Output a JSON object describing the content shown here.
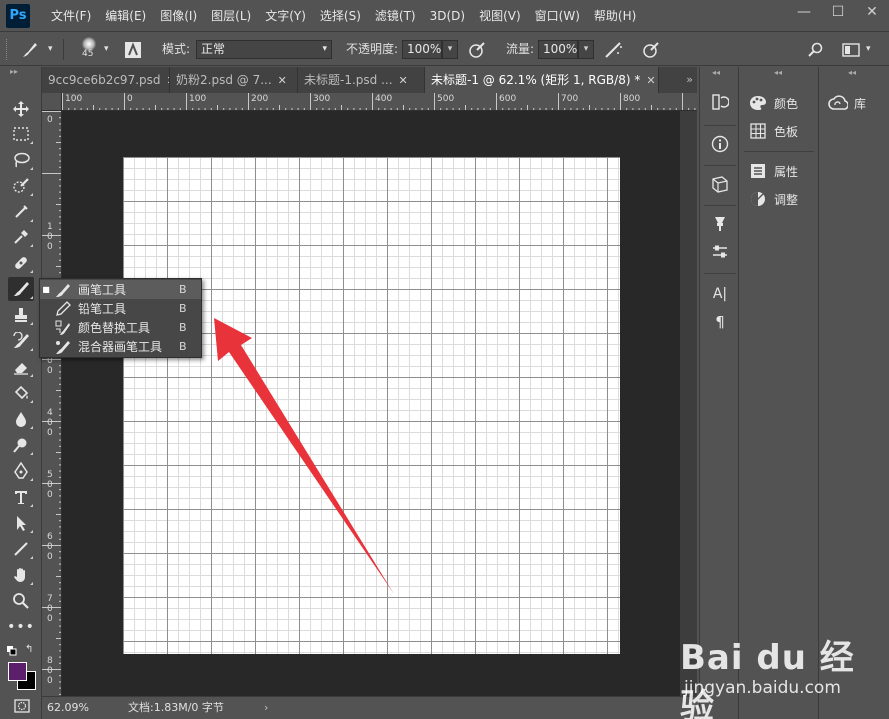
{
  "app": {
    "logo": "Ps"
  },
  "menubar": {
    "items": [
      "文件(F)",
      "编辑(E)",
      "图像(I)",
      "图层(L)",
      "文字(Y)",
      "选择(S)",
      "滤镜(T)",
      "3D(D)",
      "视图(V)",
      "窗口(W)",
      "帮助(H)"
    ]
  },
  "window_controls": {
    "minimize": "—",
    "maximize": "☐",
    "close": "✕"
  },
  "options": {
    "brush_size": "45",
    "mode_label": "模式:",
    "mode_value": "正常",
    "opacity_label": "不透明度:",
    "opacity_value": "100%",
    "flow_label": "流量:",
    "flow_value": "100%"
  },
  "tabs": [
    {
      "label": "9cc9ce6b2c97.psd",
      "close": "✕",
      "active": false
    },
    {
      "label": "奶粉2.psd @ 7...",
      "close": "✕",
      "active": false
    },
    {
      "label": "未标题-1.psd ...",
      "close": "✕",
      "active": false
    },
    {
      "label": "未标题-1 @ 62.1% (矩形 1, RGB/8) *",
      "close": "✕",
      "active": true
    }
  ],
  "tab_overflow": "»",
  "ruler": {
    "h_labels": [
      "100",
      "0",
      "100",
      "200",
      "300",
      "400",
      "500",
      "600",
      "700",
      "800"
    ],
    "v_labels": [
      "0",
      "100",
      "200",
      "300",
      "400",
      "500",
      "600",
      "700",
      "800"
    ]
  },
  "flyout": {
    "items": [
      {
        "label": "画笔工具",
        "key": "B",
        "active": true,
        "icon": "brush-icon"
      },
      {
        "label": "铅笔工具",
        "key": "B",
        "active": false,
        "icon": "pencil-icon"
      },
      {
        "label": "颜色替换工具",
        "key": "B",
        "active": false,
        "icon": "color-replacement-icon"
      },
      {
        "label": "混合器画笔工具",
        "key": "B",
        "active": false,
        "icon": "mixer-brush-icon"
      }
    ],
    "active_marker": "■"
  },
  "statusbar": {
    "zoom": "62.09%",
    "doc_info": "文档:1.83M/0 字节",
    "arrow": "›"
  },
  "panels": {
    "color": "颜色",
    "swatches": "色板",
    "properties": "属性",
    "adjustments": "调整",
    "libraries": "库"
  },
  "colors": {
    "foreground": "#5b1f6b",
    "background": "#000000",
    "annotation_arrow": "#e8333b"
  },
  "watermark": {
    "logo": "Bai du 经验",
    "url": "jingyan.baidu.com"
  }
}
